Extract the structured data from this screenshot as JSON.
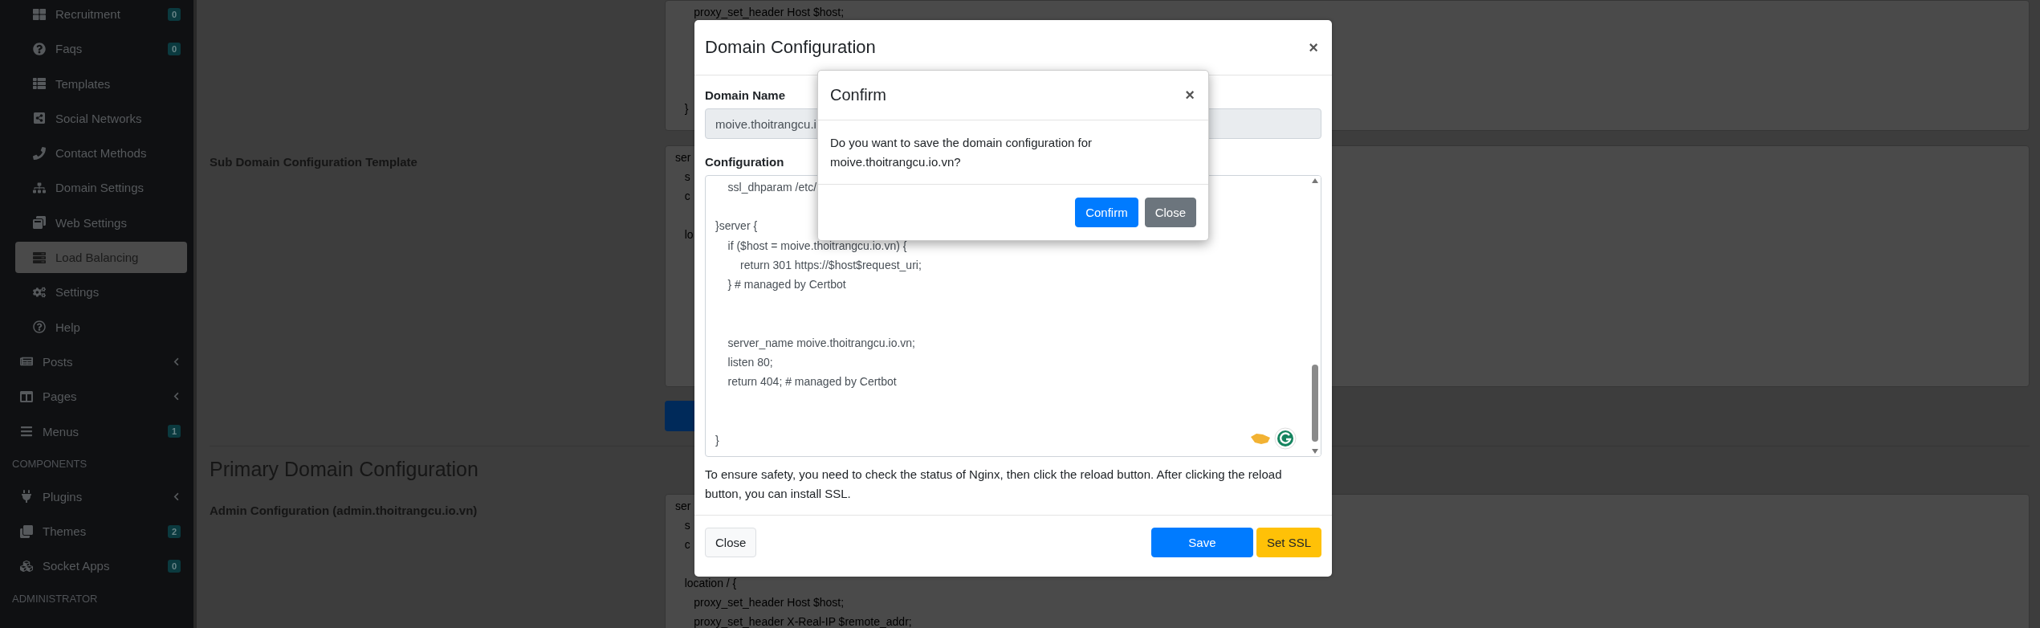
{
  "sidebar": {
    "items": [
      {
        "kind": "group",
        "children": [
          {
            "label": "Recruitment",
            "badge": "0",
            "selected": false
          },
          {
            "label": "Faqs",
            "badge": "0",
            "selected": false
          },
          {
            "label": "Templates",
            "selected": false
          },
          {
            "label": "Social Networks",
            "selected": false
          },
          {
            "label": "Contact Methods",
            "selected": false
          },
          {
            "label": "Domain Settings",
            "selected": false
          },
          {
            "label": "Web Settings",
            "selected": false
          },
          {
            "label": "Load Balancing",
            "selected": true
          },
          {
            "label": "Settings",
            "selected": false
          },
          {
            "label": "Help",
            "selected": false
          }
        ]
      },
      {
        "kind": "link",
        "label": "Posts",
        "has_submenu": true,
        "selected": false
      },
      {
        "kind": "link",
        "label": "Pages",
        "has_submenu": true,
        "selected": false
      },
      {
        "kind": "link",
        "label": "Menus",
        "badge": "1",
        "selected": false
      },
      {
        "kind": "header",
        "label": "COMPONENTS"
      },
      {
        "kind": "link",
        "label": "Plugins",
        "has_submenu": true,
        "selected": false
      },
      {
        "kind": "link",
        "label": "Themes",
        "badge": "2",
        "selected": false
      },
      {
        "kind": "link",
        "label": "Socket Apps",
        "badge": "0",
        "selected": false
      },
      {
        "kind": "header",
        "label": "ADMINISTRATOR"
      }
    ]
  },
  "page": {
    "sections": [
      {
        "kind": "config",
        "code": "      proxy_set_header Host $host;\n\n\n\n\n   }"
      },
      {
        "kind": "config",
        "label": "Sub Domain Configuration Template",
        "code": "ser\n   s\n   c\n\n   lo",
        "has_action": true
      },
      {
        "kind": "heading",
        "label": "Primary Domain Configuration"
      },
      {
        "kind": "config",
        "label": "Admin Configuration (admin.thoitrangcu.io.vn)",
        "code": "ser\n   s\n   c\n\n   location / {\n      proxy_set_header Host $host;\n      proxy_set_header X-Real-IP $remote_addr;"
      }
    ]
  },
  "domain_modal": {
    "title": "Domain Configuration",
    "close": "×",
    "domain_label": "Domain Name",
    "domain_value": "moive.thoitrangcu.i",
    "config_label": "Configuration",
    "config_value": "    ssl_dhparam /etc/\n\n}server {\n    if ($host = moive.thoitrangcu.io.vn) {\n        return 301 https://$host$request_uri;\n    } # managed by Certbot\n\n\n    server_name moive.thoitrangcu.io.vn;\n    listen 80;\n    return 404; # managed by Certbot\n\n\n}",
    "help": "To ensure safety, you need to check the status of Nginx, then click the reload button. After clicking the reload button, you can install SSL.",
    "buttons": [
      {
        "label": "Close",
        "kind": "light"
      },
      {
        "label": "Save",
        "kind": "primary"
      },
      {
        "label": "Set SSL",
        "kind": "warning"
      }
    ]
  },
  "confirm_modal": {
    "title": "Confirm",
    "close": "×",
    "message": "Do you want to save the domain configuration for moive.thoitrangcu.io.vn?",
    "buttons": [
      {
        "label": "Confirm",
        "kind": "primary"
      },
      {
        "label": "Close",
        "kind": "secondary"
      }
    ]
  }
}
